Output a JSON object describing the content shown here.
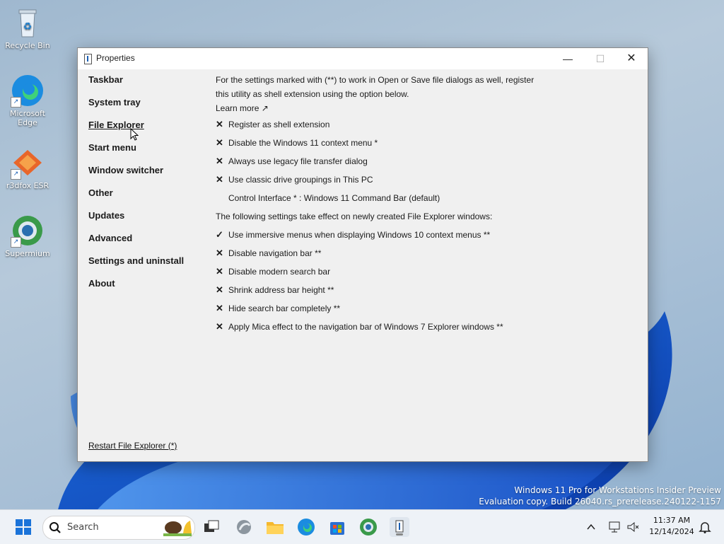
{
  "desktop": {
    "icons": [
      {
        "label": "Recycle Bin"
      },
      {
        "label": "Microsoft Edge"
      },
      {
        "label": "r3dfox ESR"
      },
      {
        "label": "Supermium"
      }
    ],
    "watermark": {
      "line1": "Windows 11 Pro for Workstations Insider Preview",
      "line2": "Evaluation copy. Build 26040.rs_prerelease.240122-1157"
    }
  },
  "window": {
    "title": "Properties",
    "controls": {
      "minimize": "—",
      "maximize": "☐",
      "close": "✕"
    },
    "nav": [
      {
        "label": "Taskbar"
      },
      {
        "label": "System tray"
      },
      {
        "label": "File Explorer"
      },
      {
        "label": "Start menu"
      },
      {
        "label": "Window switcher"
      },
      {
        "label": "Other"
      },
      {
        "label": "Updates"
      },
      {
        "label": "Advanced"
      },
      {
        "label": "Settings and uninstall"
      },
      {
        "label": "About"
      }
    ],
    "active_nav": "File Explorer",
    "restart_link": "Restart File Explorer (*)",
    "content": {
      "intro_line1": "For the settings marked with (**) to work in Open or Save file dialogs as well, register",
      "intro_line2": "this utility as shell extension using the option below.",
      "learn_more": "Learn more ↗",
      "options_a": [
        {
          "mark": "✕",
          "label": "Register as shell extension"
        },
        {
          "mark": "✕",
          "label": "Disable the Windows 11 context menu *"
        },
        {
          "mark": "✕",
          "label": "Always use legacy file transfer dialog"
        },
        {
          "mark": "✕",
          "label": "Use classic drive groupings in This PC"
        }
      ],
      "control_interface": "Control Interface * : Windows 11 Command Bar (default)",
      "section_note": "The following settings take effect on newly created File Explorer windows:",
      "options_b": [
        {
          "mark": "✓",
          "label": "Use immersive menus when displaying Windows 10 context menus **"
        },
        {
          "mark": "✕",
          "label": "Disable navigation bar **"
        },
        {
          "mark": "✕",
          "label": "Disable modern search bar"
        },
        {
          "mark": "✕",
          "label": "Shrink address bar height **"
        },
        {
          "mark": "✕",
          "label": "Hide search bar completely **"
        },
        {
          "mark": "✕",
          "label": "Apply Mica effect to the navigation bar of Windows 7 Explorer windows **"
        }
      ]
    }
  },
  "taskbar": {
    "search_placeholder": "Search",
    "time": "11:37 AM",
    "date": "12/14/2024"
  }
}
